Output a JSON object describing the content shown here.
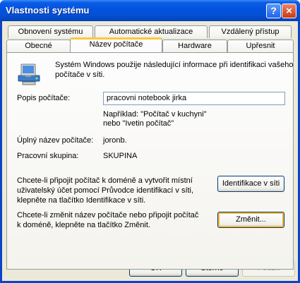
{
  "window": {
    "title": "Vlastnosti systému",
    "help_symbol": "?",
    "close_symbol": "×"
  },
  "tabs": {
    "row_back": [
      "Obnovení systému",
      "Automatické aktualizace",
      "Vzdálený přístup"
    ],
    "row_front": [
      "Obecné",
      "Název počítače",
      "Hardware",
      "Upřesnit"
    ],
    "active": "Název počítače"
  },
  "panel": {
    "intro_line1": "Systém Windows použije následující informace při identifikaci vašeho",
    "intro_line2": "počítače v síti.",
    "description_label": "Popis počítače:",
    "description_value": "pracovni notebook jirka",
    "example_line1": "Například: \"Počítač v kuchyni\"",
    "example_line2": "nebo \"Ivetin počítač\"",
    "full_name_label": "Úplný název počítače:",
    "full_name_value": "joronb.",
    "workgroup_label": "Pracovní skupina:",
    "workgroup_value": "SKUPINA",
    "domain_text_line1": "Chcete-li připojit počítač k doméně a vytvořit místní",
    "domain_text_line2": "uživatelský účet pomocí Průvodce identifikací v síti,",
    "domain_text_line3": "klepněte na tlačítko Identifikace v síti.",
    "network_id_button": "Identifikace v síti",
    "rename_text_line1": "Chcete-li změnit název počítače nebo připojit počítač",
    "rename_text_line2": "k doméně, klepněte na tlačítko Změnit.",
    "change_button": "Změnit..."
  },
  "footer": {
    "ok": "OK",
    "cancel": "Storno",
    "apply": "Použít"
  },
  "icons": {
    "computer": "computer-network-icon"
  }
}
